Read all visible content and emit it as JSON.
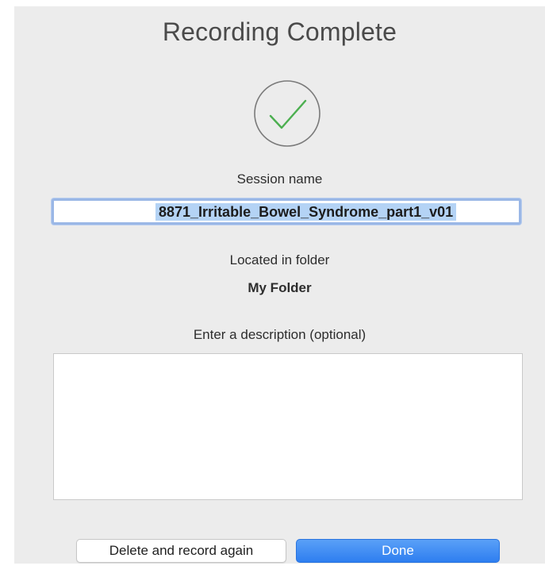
{
  "dialog": {
    "title": "Recording Complete",
    "status_icon": "checkmark-circle-icon",
    "session": {
      "label": "Session name",
      "value": "8871_Irritable_Bowel_Syndrome_part1_v01"
    },
    "folder": {
      "label": "Located in folder",
      "name": "My Folder"
    },
    "description": {
      "label": "Enter a description (optional)",
      "value": ""
    },
    "buttons": {
      "delete_label": "Delete and record again",
      "done_label": "Done"
    }
  },
  "colors": {
    "background": "#ececec",
    "checkmark": "#4caf50",
    "selection": "#b4d3f5",
    "primary_button": "#3b86f3"
  }
}
